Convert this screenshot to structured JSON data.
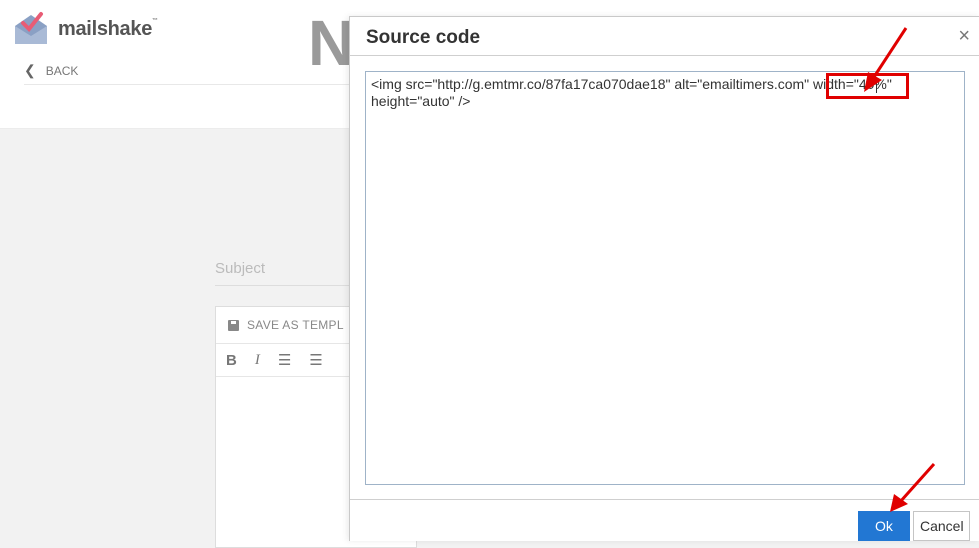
{
  "app": {
    "brand": "mailshake",
    "brand_tm": "™",
    "back_label": "BACK",
    "heading_fragment": "N",
    "subject_placeholder": "Subject",
    "save_as_template": "SAVE AS TEMPL",
    "toolbar": {
      "bold": "B",
      "italic": "I",
      "bullets": "☰",
      "numbered": "☰"
    }
  },
  "dialog": {
    "title": "Source code",
    "close_icon": "×",
    "source": "<img src=\"http://g.emtmr.co/87fa17ca070dae18\" alt=\"emailtimers.com\" width=\"40%\"\nheight=\"auto\" />",
    "ok_label": "Ok",
    "cancel_label": "Cancel"
  },
  "colors": {
    "accent": "#2277d3",
    "annotation": "#e00000"
  }
}
